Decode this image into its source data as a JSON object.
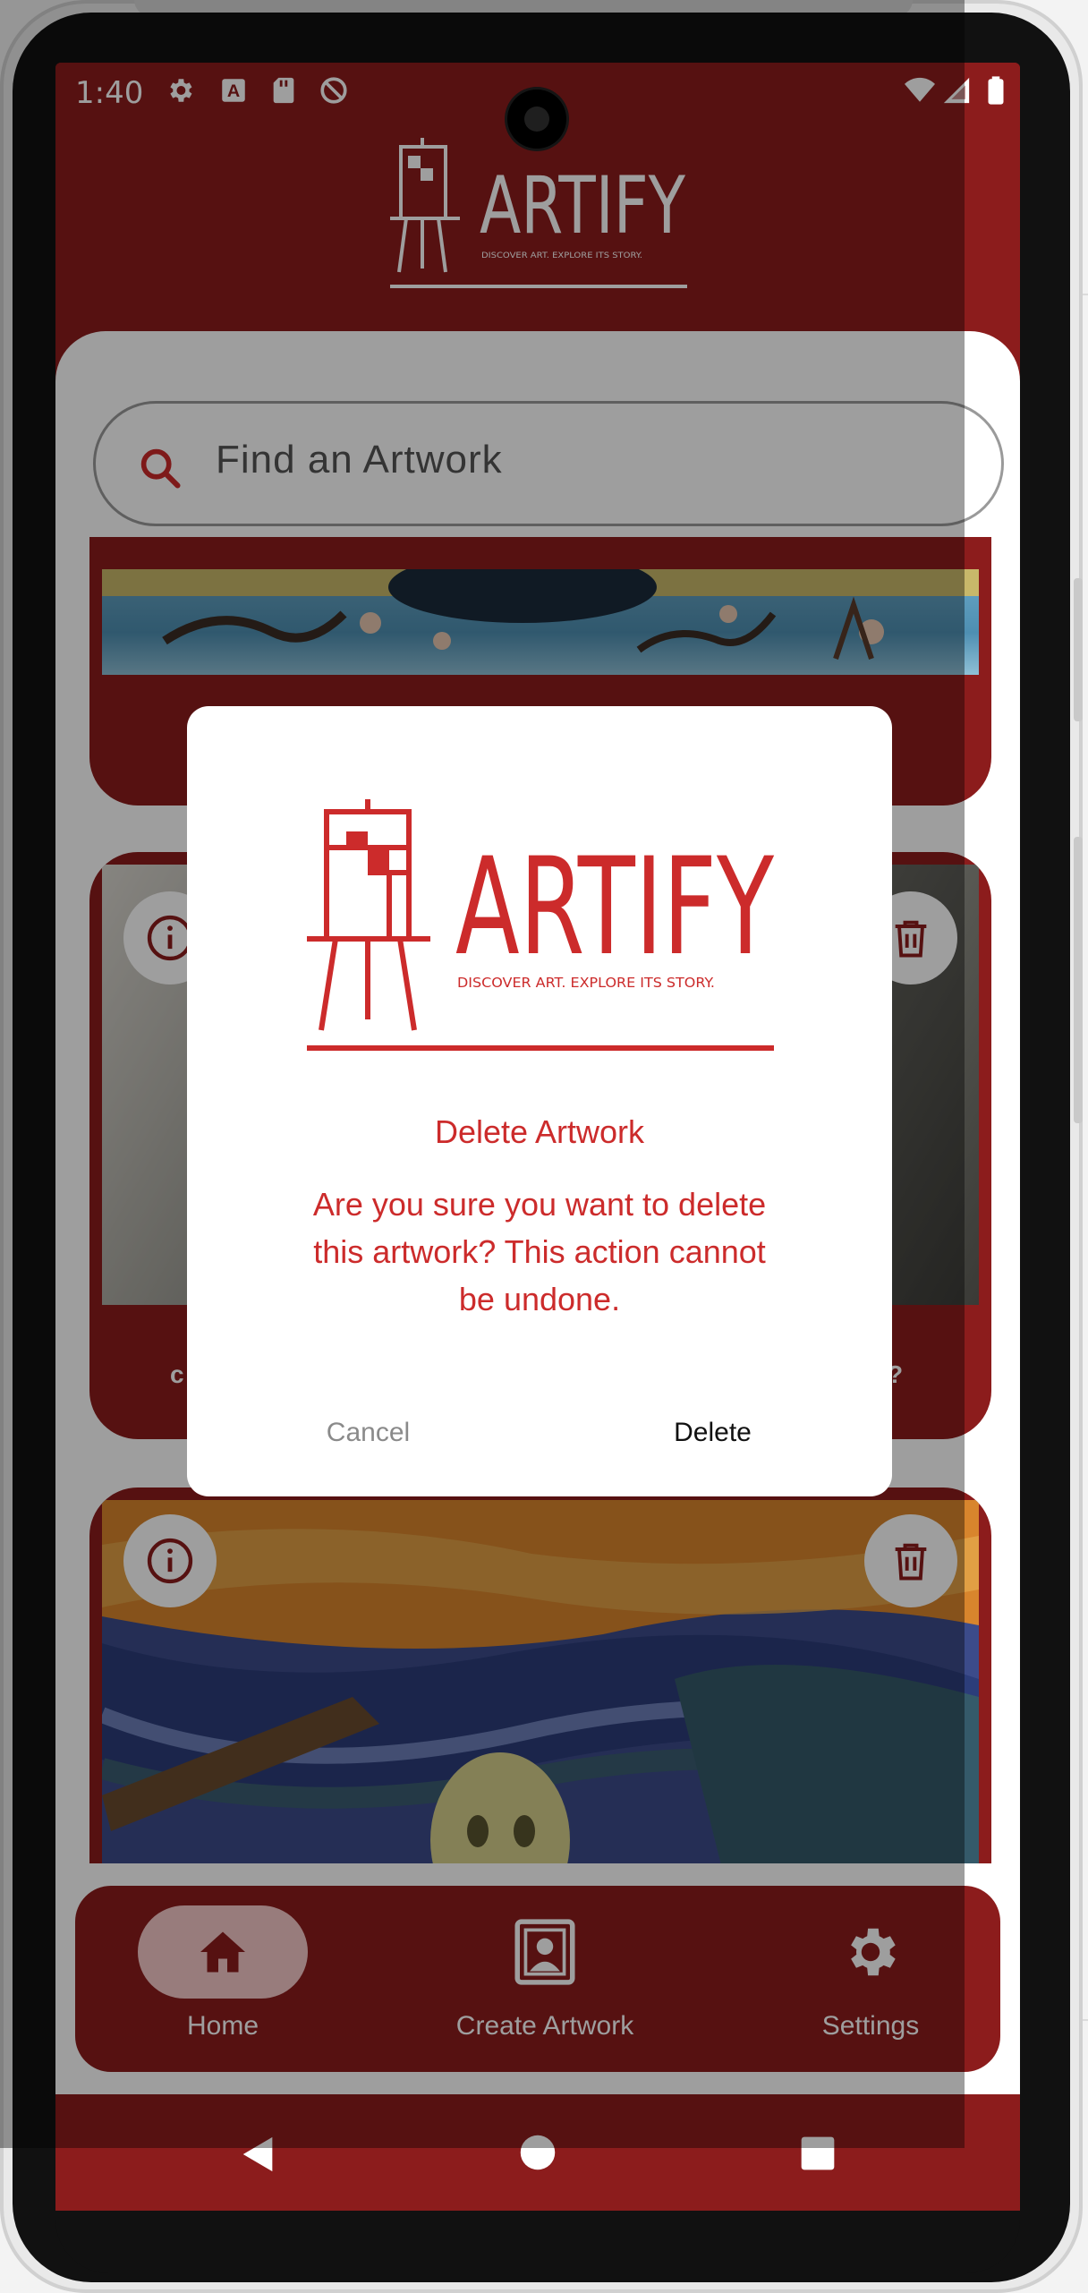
{
  "status_bar": {
    "time": "1:40"
  },
  "header": {
    "logo_text": "ARTIFY",
    "logo_tagline": "DISCOVER ART. EXPLORE ITS STORY."
  },
  "search": {
    "placeholder": "Find an Artwork"
  },
  "artworks": [
    {
      "caption": ""
    },
    {
      "caption_left": "c",
      "caption_right": "?"
    },
    {
      "caption": ""
    }
  ],
  "bottom_nav": {
    "items": [
      {
        "label": "Home",
        "icon": "home-icon",
        "active": true
      },
      {
        "label": "Create Artwork",
        "icon": "portrait-frame-icon",
        "active": false
      },
      {
        "label": "Settings",
        "icon": "gear-icon",
        "active": false
      }
    ]
  },
  "dialog": {
    "logo_text": "ARTIFY",
    "logo_tagline": "DISCOVER ART. EXPLORE ITS STORY.",
    "title": "Delete Artwork",
    "message": "Are you sure you want to delete this artwork? This action cannot be undone.",
    "cancel_label": "Cancel",
    "delete_label": "Delete"
  },
  "colors": {
    "brand": "#8c1c1c",
    "accent_red": "#cc2b2b",
    "scrim": "rgba(0,0,0,0.38)"
  }
}
